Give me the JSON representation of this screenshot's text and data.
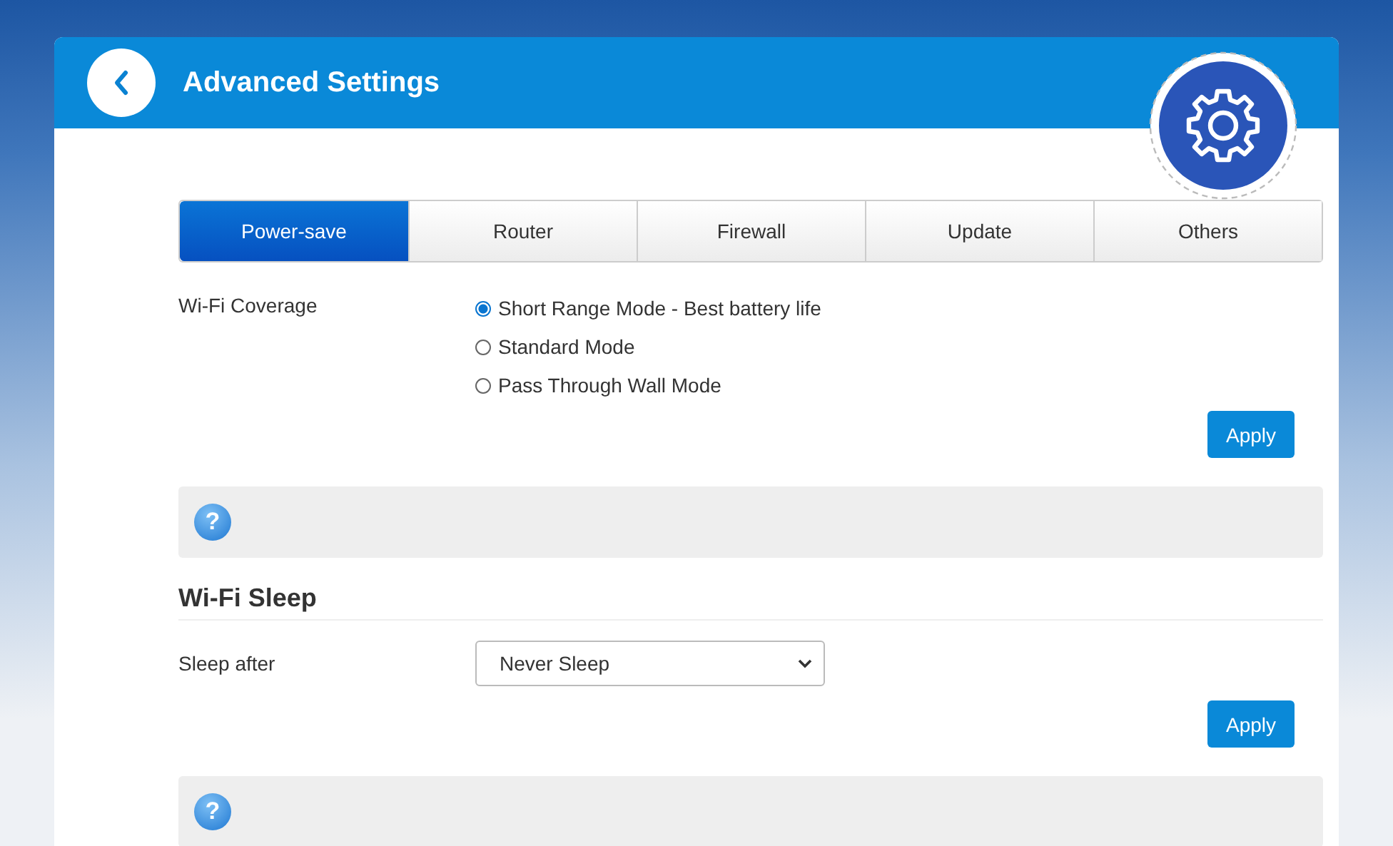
{
  "header": {
    "title": "Advanced Settings"
  },
  "tabs": [
    {
      "label": "Power-save",
      "selected": true
    },
    {
      "label": "Router",
      "selected": false
    },
    {
      "label": "Firewall",
      "selected": false
    },
    {
      "label": "Update",
      "selected": false
    },
    {
      "label": "Others",
      "selected": false
    }
  ],
  "sections": [
    {
      "kind": "radio",
      "label": "Wi-Fi Coverage",
      "options": [
        {
          "label": "Short Range Mode - Best battery life",
          "selected": true
        },
        {
          "label": "Standard Mode",
          "selected": false
        },
        {
          "label": "Pass Through Wall Mode",
          "selected": false
        }
      ],
      "button": "Apply",
      "help": "?"
    },
    {
      "kind": "select",
      "heading": "Wi-Fi Sleep",
      "label": "Sleep after",
      "value": "Never Sleep",
      "button": "Apply",
      "help": "?"
    }
  ]
}
